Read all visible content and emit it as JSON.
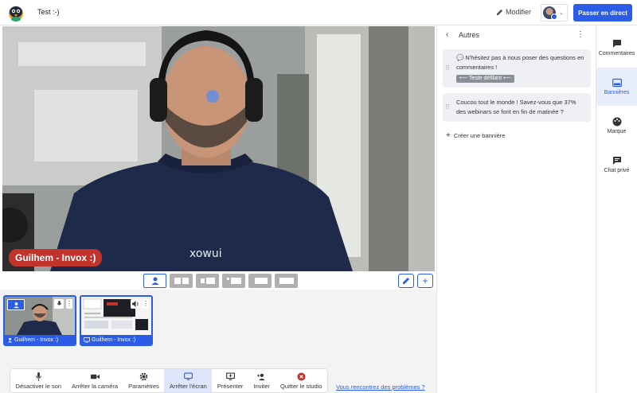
{
  "header": {
    "title": "Test :-)",
    "edit_label": "Modifier",
    "golive_label": "Passer en direct"
  },
  "stage": {
    "name_plate": "Guilhem - Invox :)"
  },
  "sources": [
    {
      "label": "Guilhem - Invox :)",
      "kind": "camera"
    },
    {
      "label": "Guilhem - Invox :)",
      "kind": "screen"
    }
  ],
  "controls": [
    {
      "label": "Désactiver le son",
      "icon": "mic-icon"
    },
    {
      "label": "Arrêter la caméra",
      "icon": "camera-icon"
    },
    {
      "label": "Paramètres",
      "icon": "settings-icon"
    },
    {
      "label": "Arrêter l'écran",
      "icon": "screen-icon",
      "active": true
    },
    {
      "label": "Présenter",
      "icon": "present-icon"
    },
    {
      "label": "Inviter",
      "icon": "invite-icon"
    },
    {
      "label": "Quitter le studio",
      "icon": "quit-icon"
    }
  ],
  "help_link": "Vous rencontrez des problèmes ?",
  "panel": {
    "title": "Autres",
    "banners": [
      {
        "text": "💬 N'hésitez pas à nous poser des questions en commentaires !",
        "tag": "⟵ Teste défilant ⟵"
      },
      {
        "text": "Coucou tout le monde ! Savez-vous que 37% des webinars se font en fin de matinée ?"
      }
    ],
    "create_label": "Créer une bannière"
  },
  "rail": [
    {
      "label": "Commentaires",
      "icon": "comments-icon"
    },
    {
      "label": "Bannières",
      "icon": "banner-icon",
      "active": true
    },
    {
      "label": "Marque",
      "icon": "palette-icon"
    },
    {
      "label": "Chat privé",
      "icon": "chat-icon"
    }
  ],
  "colors": {
    "accent": "#2b5ce6",
    "nameplate": "#c2332b",
    "quit": "#c2332b"
  }
}
